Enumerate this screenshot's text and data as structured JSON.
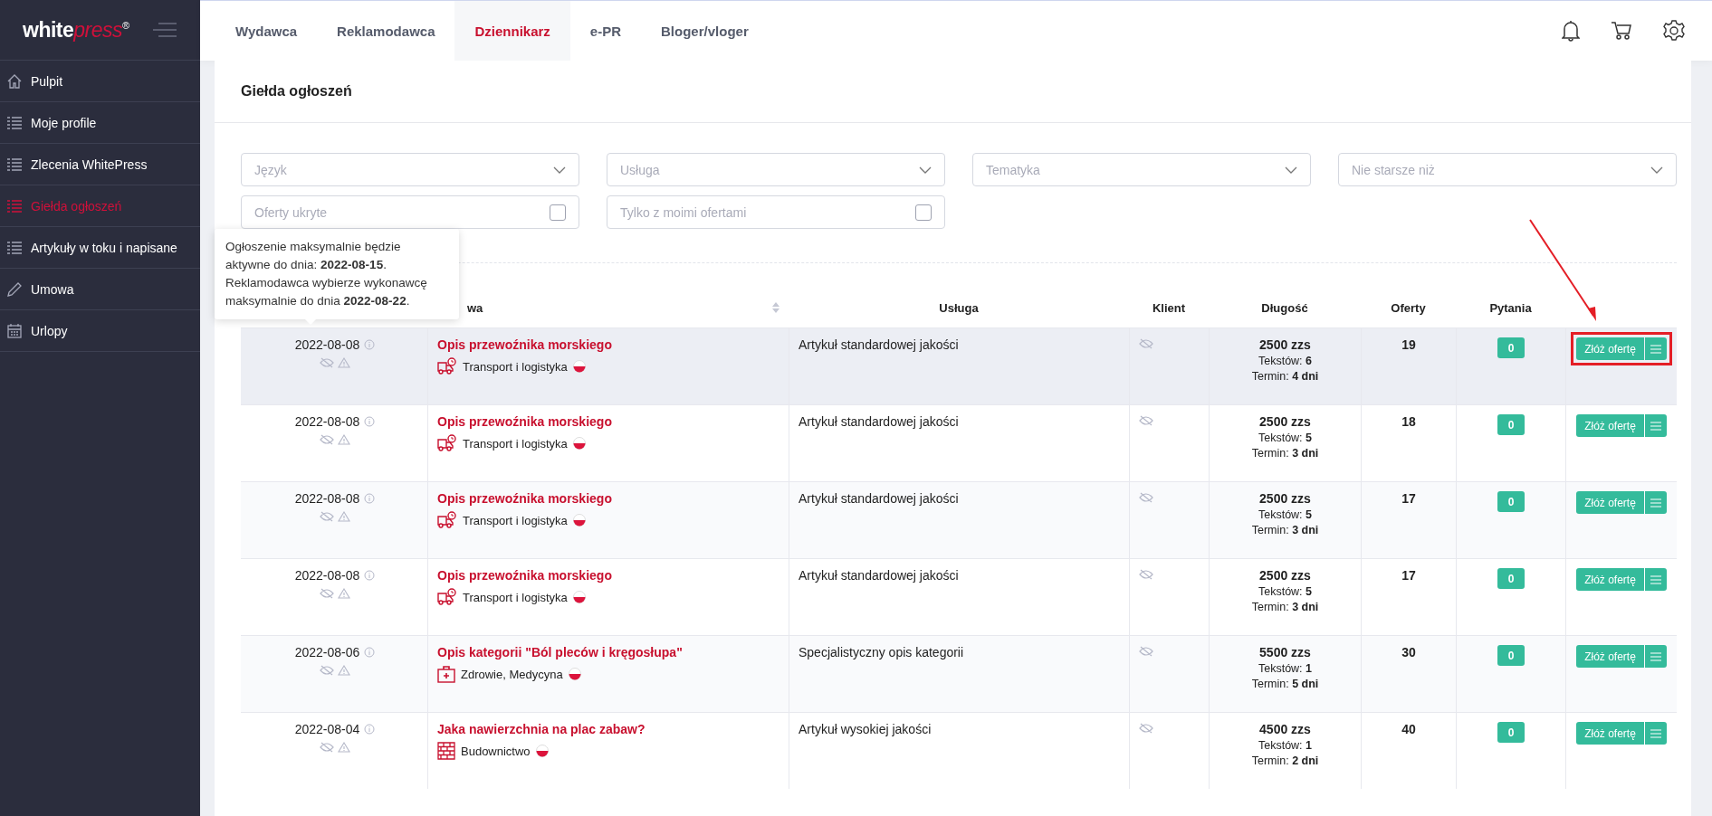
{
  "logo": {
    "main": "white",
    "accent": "press",
    "mark": "®"
  },
  "top_tabs": [
    {
      "label": "Wydawca",
      "selected": false
    },
    {
      "label": "Reklamodawca",
      "selected": false
    },
    {
      "label": "Dziennikarz",
      "selected": true
    },
    {
      "label": "e-PR",
      "selected": false
    },
    {
      "label": "Bloger/vloger",
      "selected": false
    }
  ],
  "sidebar": {
    "items": [
      {
        "label": "Pulpit",
        "kind": "home",
        "selected": false
      },
      {
        "label": "Moje profile",
        "kind": "list",
        "selected": false
      },
      {
        "label": "Zlecenia WhitePress",
        "kind": "list",
        "selected": false
      },
      {
        "label": "Giełda ogłoszeń",
        "kind": "list",
        "selected": true
      },
      {
        "label": "Artykuły w toku i napisane",
        "kind": "list",
        "selected": false
      },
      {
        "label": "Umowa",
        "kind": "pencil",
        "selected": false
      },
      {
        "label": "Urlopy",
        "kind": "calendar",
        "selected": false
      }
    ]
  },
  "page_title": "Giełda ogłoszeń",
  "filters": [
    {
      "kind": "select",
      "placeholder": "Język"
    },
    {
      "kind": "select",
      "placeholder": "Usługa"
    },
    {
      "kind": "select",
      "placeholder": "Tematyka"
    },
    {
      "kind": "select",
      "placeholder": "Nie starsze niż"
    },
    {
      "kind": "checkbox",
      "placeholder": "Oferty ukryte",
      "checked": false
    },
    {
      "kind": "checkbox",
      "placeholder": "Tylko z moimi ofertami",
      "checked": false
    }
  ],
  "tooltip": {
    "lines": [
      "Ogłoszenie maksymalnie będzie aktywne do dnia: **2022-08-15**.",
      "Reklamodawca wybierze wykonawcę maksymalnie do dnia **2022-08-22**."
    ]
  },
  "table": {
    "columns": [
      "wa",
      "Usługa",
      "Klient",
      "Długość",
      "Oferty",
      "Pytania"
    ],
    "rows": [
      {
        "date": "2022-08-08",
        "title": "Opis przewoźnika morskiego",
        "category": "Transport i logistyka",
        "kind": "truck",
        "service": "Artykuł standardowej jakości",
        "length": "2500 zzs",
        "texts": "Tekstów: **6**",
        "term": "Termin: **4 dni**",
        "offers": "19",
        "questions": "0",
        "action": "Złóż ofertę",
        "highlighted": true,
        "annotated": true
      },
      {
        "date": "2022-08-08",
        "title": "Opis przewoźnika morskiego",
        "category": "Transport i logistyka",
        "kind": "truck",
        "service": "Artykuł standardowej jakości",
        "length": "2500 zzs",
        "texts": "Tekstów: **5**",
        "term": "Termin: **3 dni**",
        "offers": "18",
        "questions": "0",
        "action": "Złóż ofertę",
        "highlighted": false,
        "annotated": false
      },
      {
        "date": "2022-08-08",
        "title": "Opis przewoźnika morskiego",
        "category": "Transport i logistyka",
        "kind": "truck",
        "service": "Artykuł standardowej jakości",
        "length": "2500 zzs",
        "texts": "Tekstów: **5**",
        "term": "Termin: **3 dni**",
        "offers": "17",
        "questions": "0",
        "action": "Złóż ofertę",
        "highlighted": false,
        "annotated": false
      },
      {
        "date": "2022-08-08",
        "title": "Opis przewoźnika morskiego",
        "category": "Transport i logistyka",
        "kind": "truck",
        "service": "Artykuł standardowej jakości",
        "length": "2500 zzs",
        "texts": "Tekstów: **5**",
        "term": "Termin: **3 dni**",
        "offers": "17",
        "questions": "0",
        "action": "Złóż ofertę",
        "highlighted": false,
        "annotated": false
      },
      {
        "date": "2022-08-06",
        "title": "Opis kategorii \"Ból pleców i kręgosłupa\"",
        "category": "Zdrowie, Medycyna",
        "kind": "medical",
        "service": "Specjalistyczny opis kategorii",
        "length": "5500 zzs",
        "texts": "Tekstów: **1**",
        "term": "Termin: **5 dni**",
        "offers": "30",
        "questions": "0",
        "action": "Złóż ofertę",
        "highlighted": false,
        "annotated": false
      },
      {
        "date": "2022-08-04",
        "title": "Jaka nawierzchnia na plac zabaw?",
        "category": "Budownictwo",
        "kind": "bricks",
        "service": "Artykuł wysokiej jakości",
        "length": "4500 zzs",
        "texts": "Tekstów: **1**",
        "term": "Termin: **2 dni**",
        "offers": "40",
        "questions": "0",
        "action": "Złóż ofertę",
        "highlighted": false,
        "annotated": false
      }
    ]
  }
}
